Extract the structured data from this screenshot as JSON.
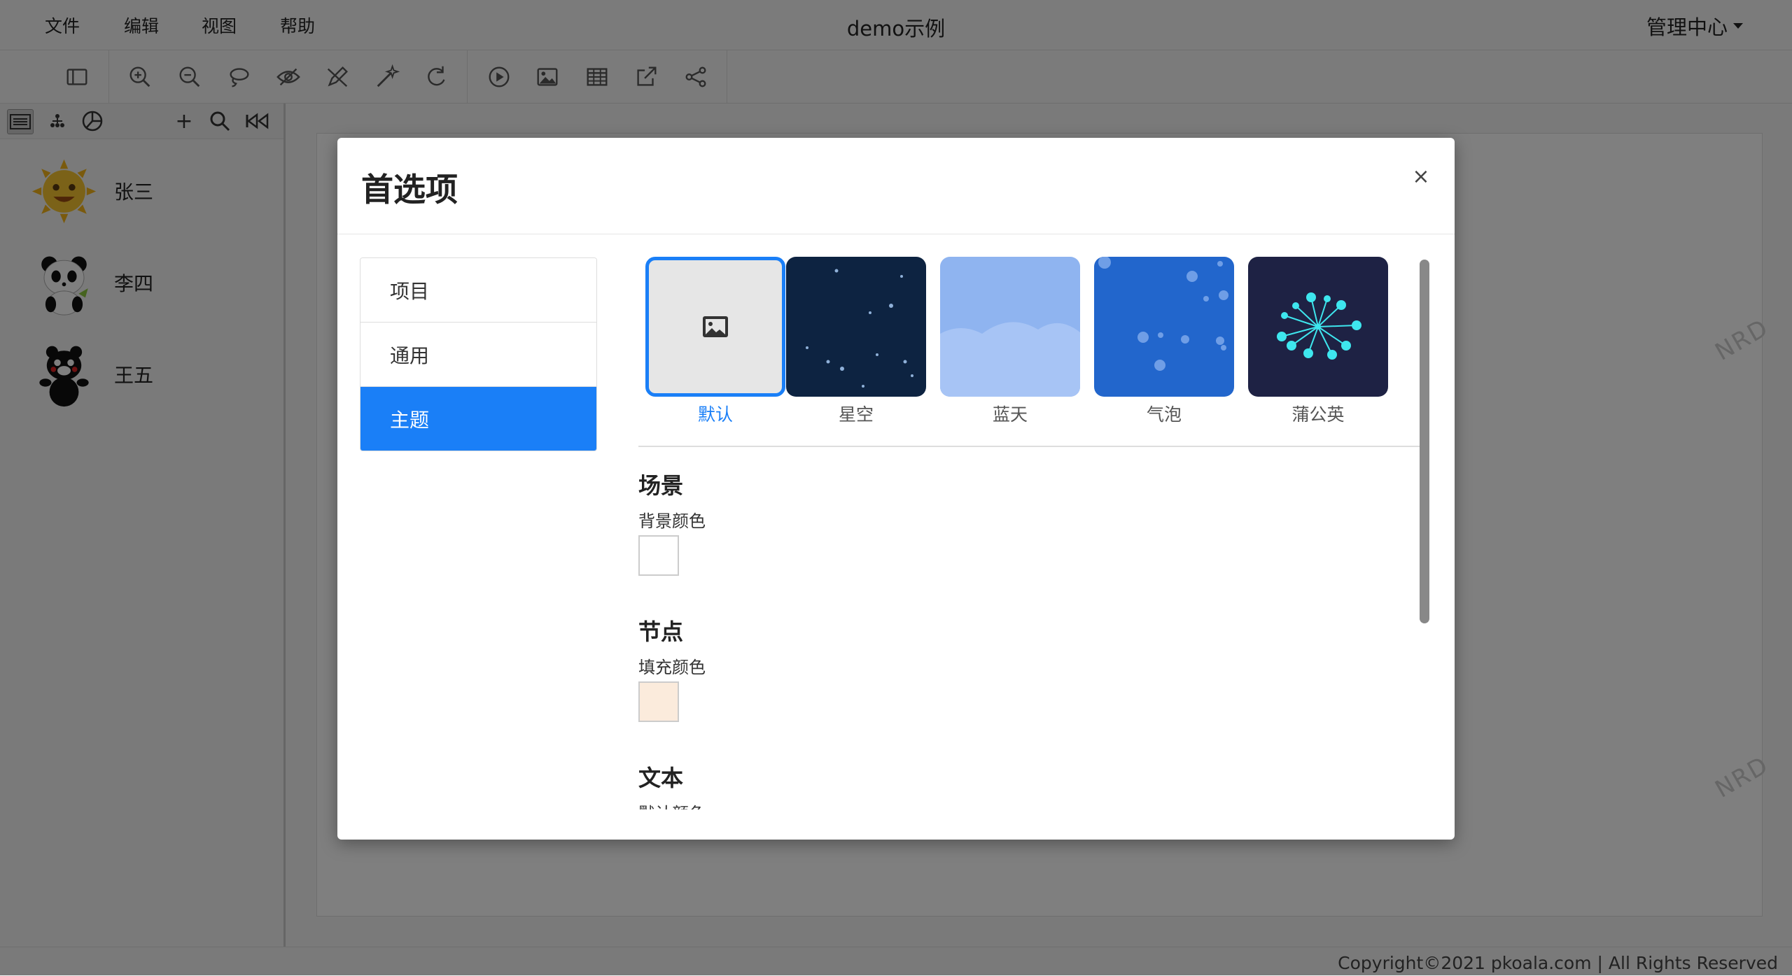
{
  "menubar": {
    "items": [
      "文件",
      "编辑",
      "视图",
      "帮助"
    ],
    "title": "demo示例",
    "admin_label": "管理中心"
  },
  "toolbar": {
    "buttons": [
      {
        "icon": "sidebar-toggle-icon"
      },
      {
        "icon": "zoom-in-icon"
      },
      {
        "icon": "zoom-out-icon"
      },
      {
        "icon": "lasso-icon"
      },
      {
        "icon": "eye-off-icon"
      },
      {
        "icon": "pen-off-icon"
      },
      {
        "icon": "magic-wand-icon"
      },
      {
        "icon": "refresh-icon"
      },
      {
        "icon": "play-icon"
      },
      {
        "icon": "image-icon"
      },
      {
        "icon": "table-icon"
      },
      {
        "icon": "export-icon"
      },
      {
        "icon": "share-icon"
      }
    ]
  },
  "sidebar": {
    "tabs": [
      {
        "icon": "list-icon"
      },
      {
        "icon": "hierarchy-icon"
      },
      {
        "icon": "pie-chart-icon"
      }
    ],
    "actions": [
      {
        "icon": "plus-icon",
        "label": "+"
      },
      {
        "icon": "search-icon"
      },
      {
        "icon": "rewind-icon"
      }
    ],
    "people": [
      {
        "name": "张三",
        "avatar": "sun-avatar"
      },
      {
        "name": "李四",
        "avatar": "panda-avatar"
      },
      {
        "name": "王五",
        "avatar": "bear-avatar"
      }
    ]
  },
  "watermark": "NRD",
  "footer": {
    "text": "Copyright©2021 pkoala.com | All Rights Reserved"
  },
  "modal": {
    "title": "首选项",
    "close": "×",
    "nav": [
      {
        "label": "项目",
        "active": false
      },
      {
        "label": "通用",
        "active": false
      },
      {
        "label": "主题",
        "active": true
      }
    ],
    "themes": [
      {
        "label": "默认",
        "selected": true,
        "color": "#e6e6e6"
      },
      {
        "label": "星空",
        "selected": false,
        "color": "#0d2341"
      },
      {
        "label": "蓝天",
        "selected": false,
        "color": "#8fb4f0"
      },
      {
        "label": "气泡",
        "selected": false,
        "color": "#2266cc"
      },
      {
        "label": "蒲公英",
        "selected": false,
        "color": "#1e2244"
      }
    ],
    "sections": [
      {
        "title": "场景",
        "field": "背景颜色",
        "color": "#ffffff"
      },
      {
        "title": "节点",
        "field": "填充颜色",
        "color": "#fbebdc"
      },
      {
        "title": "文本",
        "field": "默认颜色"
      }
    ]
  },
  "colors": {
    "accent": "#1a7ff7",
    "overlay": "rgba(0,0,0,0.5)"
  }
}
